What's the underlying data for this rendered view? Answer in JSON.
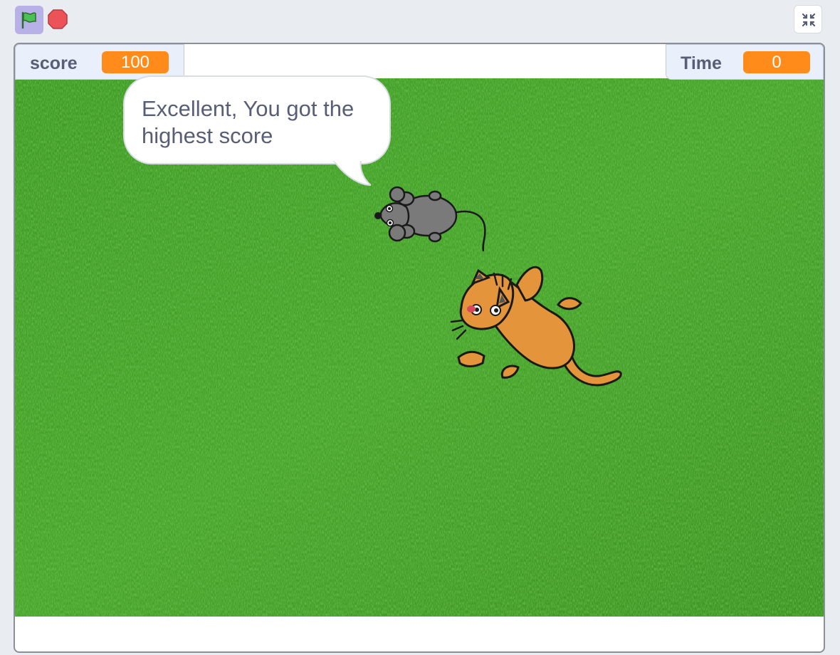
{
  "toolbar": {
    "green_flag_icon": "green-flag-icon",
    "stop_icon": "stop-icon",
    "fullscreen_icon": "exit-fullscreen-icon"
  },
  "monitors": {
    "score": {
      "label": "score",
      "value": "100"
    },
    "time": {
      "label": "Time",
      "value": "0"
    }
  },
  "speech_bubble": {
    "line1": "Excellent, You got the",
    "line2": "highest score"
  },
  "sprites": [
    "mouse",
    "cat"
  ],
  "colors": {
    "monitor_value": "#ff8c1a",
    "flag_bg": "#b8b1e8",
    "stop": "#ec5359",
    "grass": "#3f9a28",
    "cat": "#e4953c",
    "mouse": "#7a7a7a"
  }
}
